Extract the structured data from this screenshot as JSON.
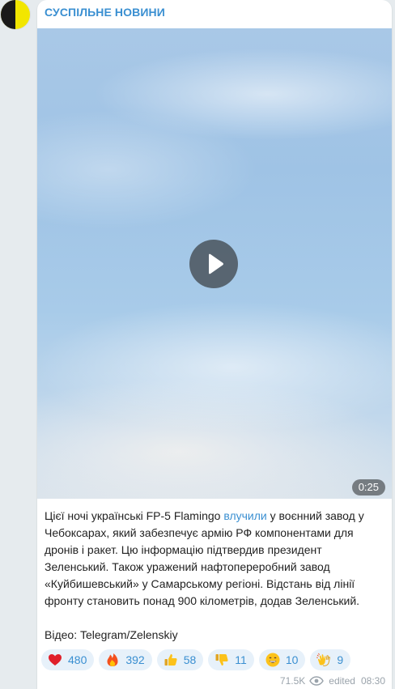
{
  "channel": {
    "name": "СУСПІЛЬНЕ НОВИНИ"
  },
  "video": {
    "duration": "0:25"
  },
  "post": {
    "text_before_link": "Цієї ночі українські FP-5 Flamingo ",
    "link_text": "влучили",
    "text_after_link": " у воєнний завод у Чебоксарах, який забезпечує армію РФ компонентами для дронів і ракет. Цю інформацію підтвердив президент Зеленський. Також уражений нафтопереробний завод «Куйбишевський» у Самарському регіоні. Відстань від лінії фронту становить понад 900 кілометрів, додав Зеленський.",
    "source": "Відео: Telegram/Zelenskiy"
  },
  "reactions": [
    {
      "icon": "heart-icon",
      "count": "480"
    },
    {
      "icon": "fire-icon",
      "count": "392"
    },
    {
      "icon": "thumbs-up-icon",
      "count": "58"
    },
    {
      "icon": "thumbs-down-icon",
      "count": "11"
    },
    {
      "icon": "grinning-face-icon",
      "count": "10"
    },
    {
      "icon": "clapping-hands-icon",
      "count": "9"
    }
  ],
  "meta": {
    "views": "71.5K",
    "edited": "edited",
    "time": "08:30"
  },
  "colors": {
    "accent": "#3a8fd1",
    "reaction_bg": "#e7f1fa",
    "background": "#e6ebee"
  }
}
